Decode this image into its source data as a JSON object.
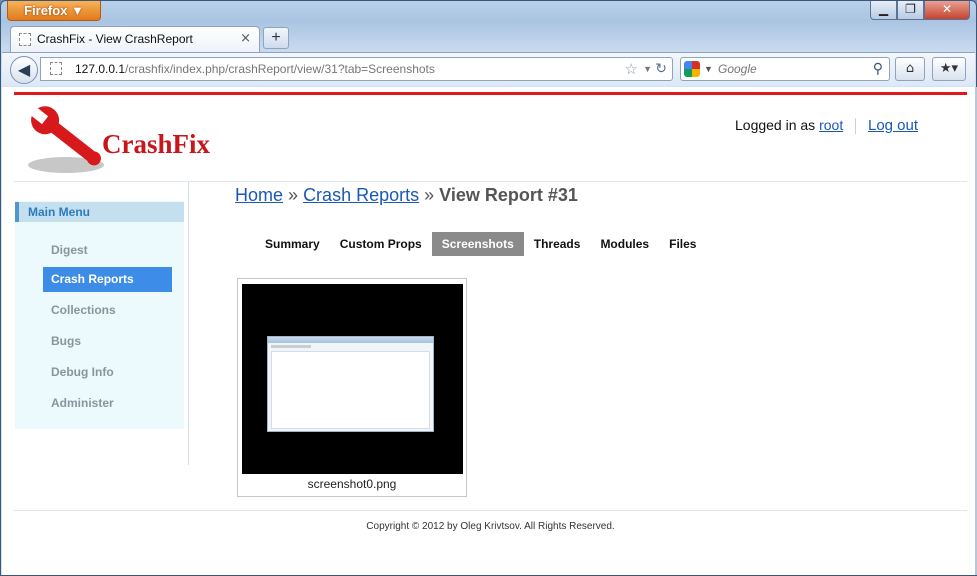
{
  "browser": {
    "menu_button": "Firefox ▼",
    "tab_title": "CrashFix - View CrashReport",
    "tab_close": "×",
    "new_tab": "+",
    "url_host": "127.0.0.1",
    "url_path": "/crashfix/index.php/crashReport/view/31?tab=Screenshots",
    "search_placeholder": "Google",
    "window_controls": {
      "minimize": "▁",
      "maximize": "❐",
      "close": "✕"
    }
  },
  "header": {
    "logo_text": "CrashFix",
    "logged_in_prefix": "Logged in as",
    "username": "root",
    "logout": "Log out"
  },
  "sidebar": {
    "title": "Main Menu",
    "items": [
      {
        "label": "Digest"
      },
      {
        "label": "Crash Reports",
        "active": true
      },
      {
        "label": "Collections"
      },
      {
        "label": "Bugs"
      },
      {
        "label": "Debug Info"
      },
      {
        "label": "Administer"
      }
    ]
  },
  "breadcrumb": {
    "home": "Home",
    "sep1": "»",
    "crash_reports": "Crash Reports",
    "sep2": "»",
    "current": "View Report #31"
  },
  "tabs": [
    {
      "label": "Summary"
    },
    {
      "label": "Custom Props"
    },
    {
      "label": "Screenshots",
      "active": true
    },
    {
      "label": "Threads"
    },
    {
      "label": "Modules"
    },
    {
      "label": "Files"
    }
  ],
  "screenshot": {
    "caption": "screenshot0.png"
  },
  "footer": {
    "copyright": "Copyright © 2012 by Oleg Krivtsov. All Rights Reserved."
  },
  "colors": {
    "accent_red": "#e3171b",
    "link_blue": "#1a58b7",
    "active_menu": "#3d8ce7",
    "active_tab": "#8a8a8a"
  }
}
